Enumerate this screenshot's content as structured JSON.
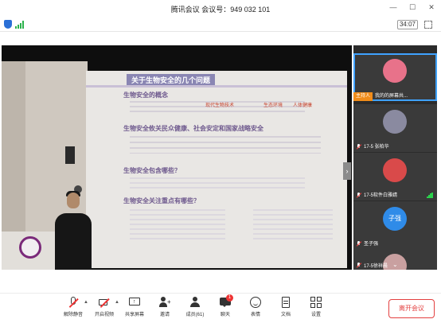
{
  "window": {
    "title": "腾讯会议  会议号：949 032 101",
    "controls": [
      "minimize-icon",
      "maximize-icon",
      "close-icon"
    ]
  },
  "status": {
    "timer": "34:07"
  },
  "slide": {
    "title": "关于生物安全的几个问题",
    "headings": [
      "生物安全的概念",
      "生物安全攸关民众健康、社会安定和国家战略安全",
      "生物安全包含哪些？",
      "生物安全关注重点有哪些？"
    ],
    "highlights": [
      "现代生物技术",
      "生态环境",
      "人体健康"
    ]
  },
  "participants": [
    {
      "name": "",
      "host_label": "主持人",
      "status": "我的的屏幕共...",
      "avatar_color": "#e8728a",
      "active": true
    },
    {
      "name": "17-5 张柏华",
      "avatar_color": "#8a8aa0"
    },
    {
      "name": "17-5软件白雅婧",
      "avatar_color": "#d94a4a"
    },
    {
      "name": "圣子强",
      "avatar_text": "子强",
      "avatar_color": "#2f8be8"
    },
    {
      "name": "17-5徐祥晨",
      "avatar_color": "#c9a0a0"
    }
  ],
  "toolbar": {
    "mute": "解除静音",
    "video": "开启视频",
    "share": "共享屏幕",
    "invite": "邀请",
    "members": "成员(61)",
    "chat": "聊天",
    "chat_badge": "1",
    "reactions": "表情",
    "docs": "文档",
    "settings": "设置",
    "leave": "离开会议"
  },
  "colors": {
    "accent_blue": "#3fa2ff",
    "leave_red": "#e34040",
    "host_orange": "#f08c1a"
  }
}
